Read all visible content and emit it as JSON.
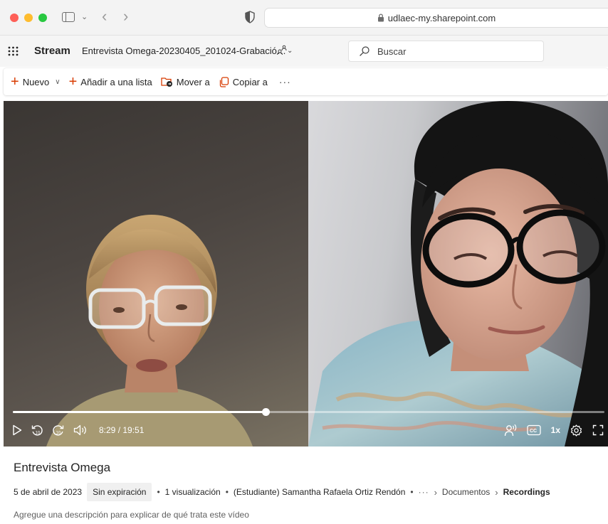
{
  "browser": {
    "url": "udlaec-my.sharepoint.com",
    "back_glyph": "‹",
    "forward_glyph": "›",
    "sidebar_menu_glyph": "⌄"
  },
  "header": {
    "app_name": "Stream",
    "file_title": "Entrevista Omega-20230405_201024-Grabació…",
    "title_chevron": "⌄",
    "search": {
      "placeholder": "Buscar",
      "value": ""
    }
  },
  "command_bar": {
    "new_label": "Nuevo",
    "add_to_list_label": "Añadir a una lista",
    "move_label": "Mover a",
    "copy_label": "Copiar a",
    "more_label": "···",
    "plus_glyph": "+",
    "dropdown_glyph": "∨"
  },
  "player": {
    "current_time": "8:29",
    "duration": "19:51",
    "time_display": "8:29 / 19:51",
    "progress_fraction": 0.427,
    "speed": "1x",
    "skip_back_seconds": "10",
    "skip_forward_seconds": "10"
  },
  "video": {
    "title": "Entrevista Omega",
    "date": "5 de abril de 2023",
    "expiration": "Sin expiración",
    "views": "1 visualización",
    "owner": "(Estudiante) Samantha Rafaela Ortiz Rendón",
    "bullet": "•",
    "breadcrumb_ellipsis": "···",
    "breadcrumb_separator": "›",
    "breadcrumb": [
      "Documentos",
      "Recordings"
    ],
    "description_placeholder": "Agregue una descripción para explicar de qué trata este vídeo"
  },
  "colors": {
    "accent": "#d83b01",
    "traffic_red": "#fe5f57",
    "traffic_yellow": "#febc2e",
    "traffic_green": "#28c840"
  },
  "icons": [
    "sidebar-toggle-icon",
    "shield-icon",
    "lock-icon",
    "waffle-icon",
    "share-people-icon",
    "search-icon",
    "plus-icon",
    "add-list-icon",
    "move-folder-icon",
    "copy-icon",
    "play-icon",
    "skip-back-icon",
    "skip-forward-icon",
    "volume-icon",
    "noise-suppression-icon",
    "captions-icon",
    "settings-gear-icon",
    "fullscreen-icon"
  ]
}
